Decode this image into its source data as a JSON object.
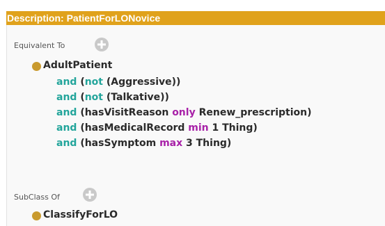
{
  "header": {
    "title": "Description: PatientForLONovice",
    "bg_color": "#e0a21c"
  },
  "equivalent_section": {
    "label": "Equivalent To",
    "add_icon": "add-icon",
    "class_name": "AdultPatient",
    "expressions": [
      {
        "kw": "and",
        "open": "(",
        "not": "not",
        "inner": "(Aggressive))",
        "restriction": "",
        "quant": "",
        "rest": ""
      },
      {
        "kw": "and",
        "open": "(",
        "not": "not",
        "inner": "(Talkative))",
        "restriction": "",
        "quant": "",
        "rest": ""
      },
      {
        "kw": "and",
        "open": "",
        "not": "",
        "inner": "",
        "restriction": "(hasVisitReason",
        "quant": "only",
        "rest": "Renew_prescription)"
      },
      {
        "kw": "and",
        "open": "",
        "not": "",
        "inner": "",
        "restriction": "(hasMedicalRecord",
        "quant": "min",
        "rest": "1 Thing)"
      },
      {
        "kw": "and",
        "open": "",
        "not": "",
        "inner": "",
        "restriction": "(hasSymptom",
        "quant": "max",
        "rest": "3 Thing)"
      }
    ]
  },
  "subclass_section": {
    "label": "SubClass Of",
    "add_icon": "add-icon",
    "class_name": "ClassifyForLO"
  },
  "colors": {
    "keyword_and_not": "#23a59b",
    "quantifier": "#a821a8",
    "class_dot": "#c99a2e"
  }
}
